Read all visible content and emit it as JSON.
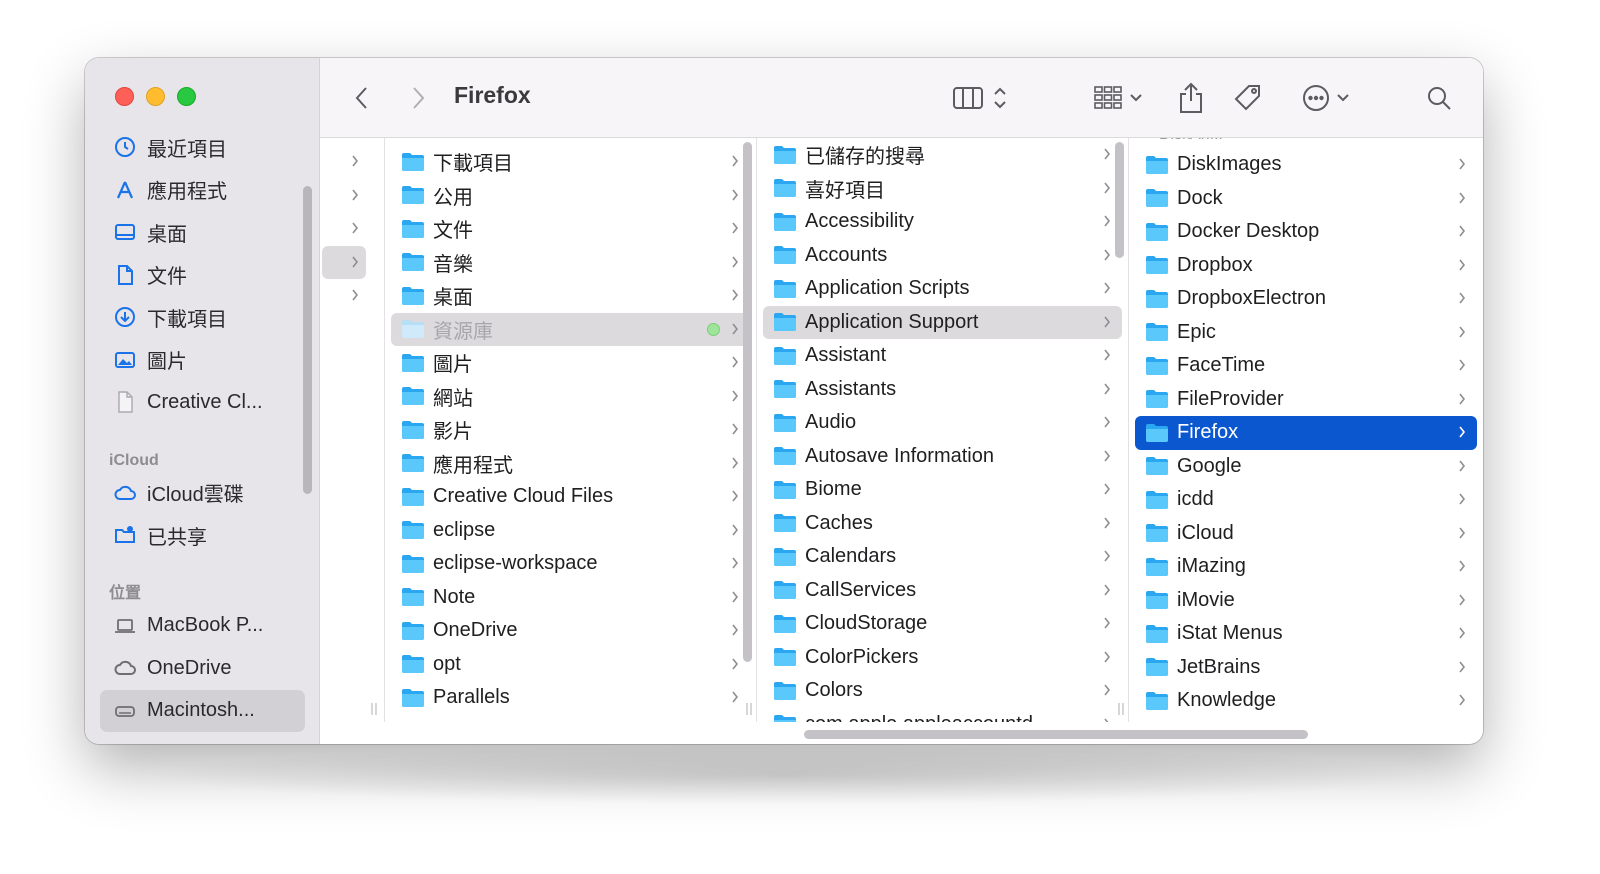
{
  "window": {
    "title": "Firefox"
  },
  "sidebar": {
    "favorites": [
      {
        "label": "最近項目",
        "icon": "clock-icon"
      },
      {
        "label": "應用程式",
        "icon": "apps-icon"
      },
      {
        "label": "桌面",
        "icon": "desktop-icon"
      },
      {
        "label": "文件",
        "icon": "document-icon"
      },
      {
        "label": "下載項目",
        "icon": "download-icon"
      },
      {
        "label": "圖片",
        "icon": "photo-icon"
      },
      {
        "label": "Creative Cl...",
        "icon": "file-icon"
      }
    ],
    "icloud_heading": "iCloud",
    "icloud": [
      {
        "label": "iCloud雲碟",
        "icon": "cloud-icon"
      },
      {
        "label": "已共享",
        "icon": "shared-folder-icon"
      }
    ],
    "locations_heading": "位置",
    "locations": [
      {
        "label": "MacBook P...",
        "icon": "laptop-icon"
      },
      {
        "label": "OneDrive",
        "icon": "cloud-icon"
      },
      {
        "label": "Macintosh...",
        "icon": "disk-icon"
      }
    ]
  },
  "column1": {
    "items": [
      {
        "label": "下載項目",
        "icon": "download-folder-icon"
      },
      {
        "label": "公用",
        "icon": "public-folder-icon"
      },
      {
        "label": "文件",
        "icon": "documents-folder-icon"
      },
      {
        "label": "音樂",
        "icon": "music-folder-icon"
      },
      {
        "label": "桌面",
        "icon": "desktop-folder-icon"
      },
      {
        "label": "資源庫",
        "icon": "library-folder-icon"
      },
      {
        "label": "圖片",
        "icon": "pictures-folder-icon"
      },
      {
        "label": "網站",
        "icon": "sites-folder-icon"
      },
      {
        "label": "影片",
        "icon": "movies-folder-icon"
      },
      {
        "label": "應用程式",
        "icon": "applications-folder-icon"
      },
      {
        "label": "Creative Cloud Files",
        "icon": "cc-folder-icon"
      },
      {
        "label": "eclipse",
        "icon": "folder-icon"
      },
      {
        "label": "eclipse-workspace",
        "icon": "folder-icon"
      },
      {
        "label": "Note",
        "icon": "folder-icon"
      },
      {
        "label": "OneDrive",
        "icon": "alias-folder-icon"
      },
      {
        "label": "opt",
        "icon": "folder-icon"
      },
      {
        "label": "Parallels",
        "icon": "folder-icon"
      }
    ]
  },
  "column2": {
    "items": [
      "已儲存的搜尋",
      "喜好項目",
      "Accessibility",
      "Accounts",
      "Application Scripts",
      "Application Support",
      "Assistant",
      "Assistants",
      "Audio",
      "Autosave Information",
      "Biome",
      "Caches",
      "Calendars",
      "CallServices",
      "CloudStorage",
      "ColorPickers",
      "Colors",
      "com.apple.appleaccountd"
    ]
  },
  "column3": {
    "partial_top": "DiskAri...",
    "items": [
      "DiskImages",
      "Dock",
      "Docker Desktop",
      "Dropbox",
      "DropboxElectron",
      "Epic",
      "FaceTime",
      "FileProvider",
      "Firefox",
      "Google",
      "icdd",
      "iCloud",
      "iMazing",
      "iMovie",
      "iStat Menus",
      "JetBrains",
      "Knowledge"
    ]
  },
  "colors": {
    "selection": "#0b57d0",
    "folder": "#5ac8fa"
  }
}
